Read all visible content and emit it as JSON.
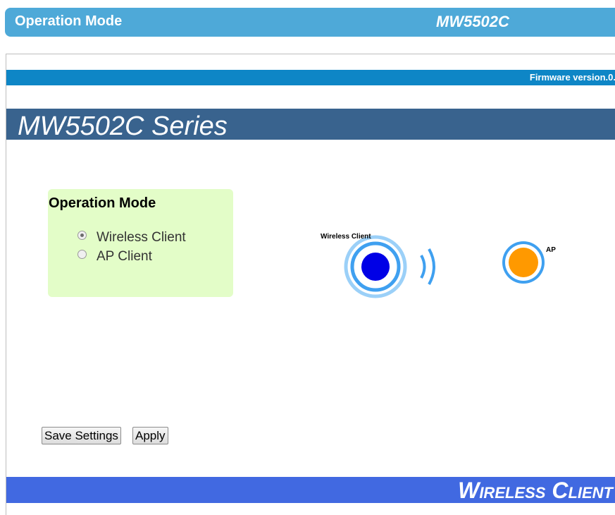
{
  "header": {
    "title": "Operation Mode",
    "model": "MW5502C"
  },
  "firmware_text": "Firmware version.0.",
  "series_title": "MW5502C Series",
  "operation_mode": {
    "heading": "Operation Mode",
    "options": [
      {
        "label": "Wireless Client",
        "selected": true
      },
      {
        "label": "AP Client",
        "selected": false
      }
    ]
  },
  "diagram": {
    "client_label": "Wireless Client",
    "ap_label": "AP",
    "colors": {
      "ring": "#3fa0f0",
      "client_core": "#0000e6",
      "ap_core": "#ff9900"
    }
  },
  "buttons": {
    "save": "Save Settings",
    "apply": "Apply"
  },
  "footer_text": "Wireless Client",
  "colors": {
    "topbar": "#4ea9d8",
    "firmware_bar": "#0e86c6",
    "series_bar": "#39638e",
    "option_box": "#e3fdc8",
    "footer": "#4169e1"
  }
}
